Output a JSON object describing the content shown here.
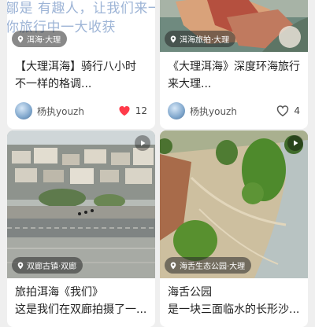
{
  "feed": {
    "cards": [
      {
        "overlay_text_line1": "鄒是 有趣人，让我们来一场",
        "overlay_text_line2": "你旅行中一大收获",
        "location": "洱海·大理",
        "title_line1": "【大理洱海】骑行八小时",
        "title_line2": "不一样的格调...",
        "author": "杨执youzh",
        "like_count": "12",
        "liked": true
      },
      {
        "location": "洱海旅拍·大理",
        "title_line1": "《大理洱海》深度环海旅行",
        "title_line2": "来大理...",
        "author": "杨执youzh",
        "like_count": "4",
        "liked": false
      },
      {
        "location": "双廊古镇·双廊",
        "title_line1": "旅拍洱海《我们》",
        "title_line2": "这是我们在双廊拍摄了一..."
      },
      {
        "location": "海舌生态公园·大理",
        "title_line1": "海舌公园",
        "title_line2": "是一块三面临水的长形沙..."
      }
    ]
  },
  "colors": {
    "like_active": "#ff3b4a",
    "like_inactive": "#555555"
  }
}
